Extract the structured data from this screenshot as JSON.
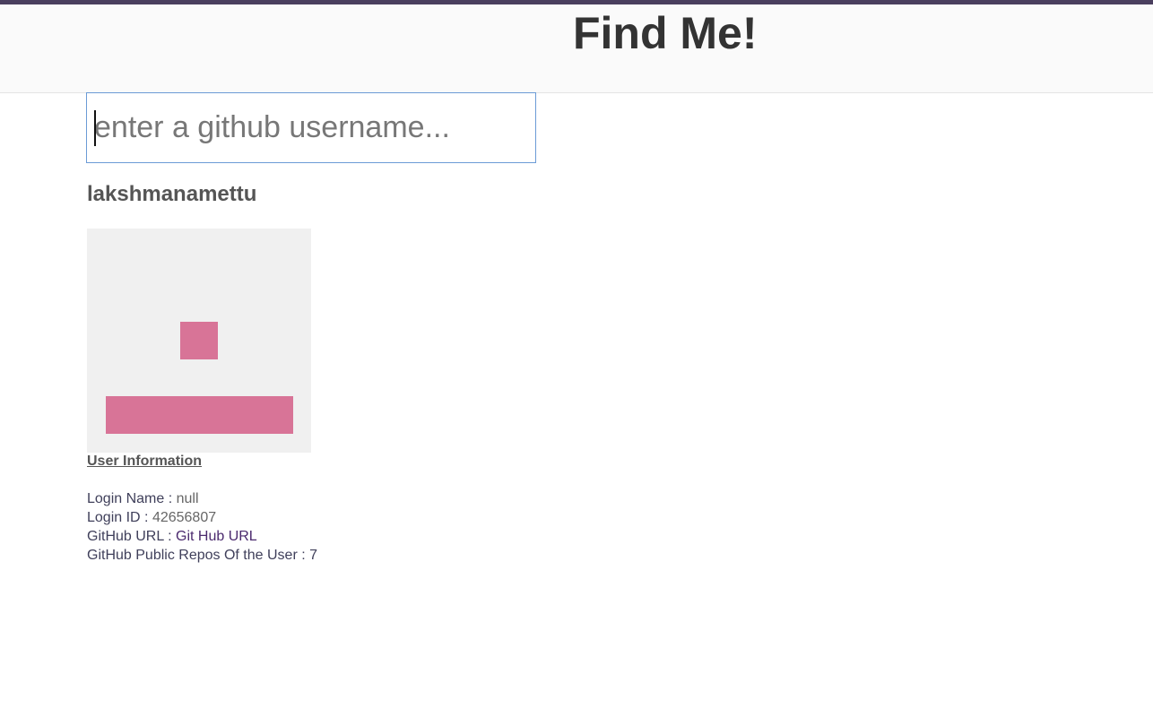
{
  "header": {
    "title": "Find Me!",
    "stripe_color": "#4a3f5e"
  },
  "search": {
    "placeholder": "enter a github username...",
    "value": ""
  },
  "profile": {
    "username": "lakshmanamettu",
    "avatar": {
      "icon": "identicon",
      "color": "#d87497",
      "background": "#f0f0f0"
    }
  },
  "user_info": {
    "heading": "User Information",
    "login_name_label": "Login Name : ",
    "login_name_value": "null",
    "login_id_label": "Login ID : ",
    "login_id_value": "42656807",
    "github_url_label": "GitHub URL : ",
    "github_url_link_text": "Git Hub URL",
    "public_repos_label": "GitHub Public Repos Of the User : ",
    "public_repos_value": "7"
  }
}
